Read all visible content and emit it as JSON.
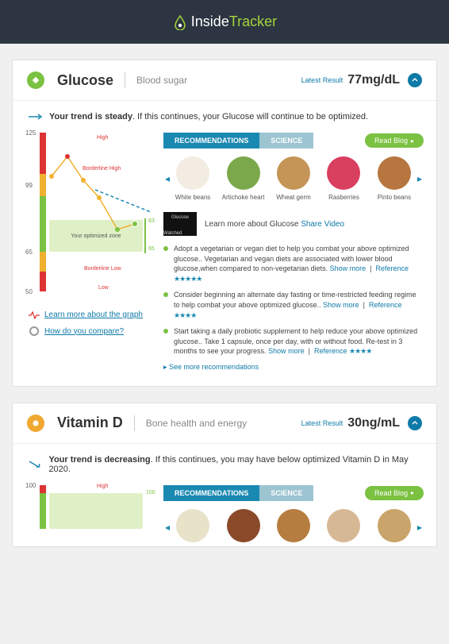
{
  "brand": {
    "name_prefix": "Inside",
    "name_suffix": "Tracker"
  },
  "panels": [
    {
      "icon_color": "green",
      "title": "Glucose",
      "subtitle": "Blood sugar",
      "latest_label": "Latest Result",
      "latest_value": "77mg/dL",
      "trend_prefix": "Your trend is steady",
      "trend_suffix": ". If this continues, your Glucose will continue to be optimized.",
      "trend_color": "#1a89b2",
      "chart": {
        "ticks": [
          "125",
          "99",
          "65",
          "50"
        ],
        "zones": [
          {
            "label": "High",
            "color": "#d33"
          },
          {
            "label": "Borderline High",
            "color": "#d33"
          },
          {
            "label": "Your optimized zone",
            "color": "#555"
          },
          {
            "label": "Borderline Low",
            "color": "#d33"
          },
          {
            "label": "Low",
            "color": "#d33"
          }
        ],
        "opt_markers": [
          "83",
          "65"
        ]
      },
      "links": {
        "learn_graph": "Learn more about the graph",
        "compare": "How do you compare?"
      },
      "tabs": {
        "rec": "RECOMMENDATIONS",
        "sci": "SCIENCE"
      },
      "blog_btn": "Read Blog",
      "foods": [
        {
          "name": "White beans",
          "color": "#f2ece2"
        },
        {
          "name": "Artichoke heart",
          "color": "#7ba84a"
        },
        {
          "name": "Wheat germ",
          "color": "#c49556"
        },
        {
          "name": "Rasberries",
          "color": "#d93f5f"
        },
        {
          "name": "Pinto beans",
          "color": "#b77640"
        }
      ],
      "video": {
        "watched": "Watched",
        "learn": "Learn more about Glucose",
        "share": "Share Video"
      },
      "recs": [
        {
          "text": "Adopt a vegetarian or vegan diet to help you combat your above optimized glucose.. Vegetarian and vegan diets are associated with lower blood glucose,when compared to non-vegetarian diets.",
          "show_more": "Show more",
          "reference": "Reference",
          "stars": "★★★★★"
        },
        {
          "text": "Consider beginning an alternate day fasting or time-restricted feeding regime to help combat your above optimized glucose..",
          "show_more": "Show more",
          "reference": "Reference",
          "stars": "★★★★"
        },
        {
          "text": "Start taking a daily probiotic supplement to help reduce your above optimized glucose.. Take 1 capsule, once per day, with or without food. Re-test in 3 months to see your progress.",
          "show_more": "Show more",
          "reference": "Reference",
          "stars": "★★★★"
        }
      ],
      "see_more": "See more recommendations"
    },
    {
      "icon_color": "orange",
      "title": "Vitamin D",
      "subtitle": "Bone health and energy",
      "latest_label": "Latest Result",
      "latest_value": "30ng/mL",
      "trend_prefix": "Your trend is decreasing",
      "trend_suffix": ". If this continues, you may have below optimized Vitamin D in May 2020.",
      "trend_color": "#1a89b2",
      "chart": {
        "ticks": [
          "100"
        ],
        "zones": [
          {
            "label": "High",
            "color": "#d33"
          }
        ],
        "opt_markers": [
          "100"
        ]
      },
      "tabs": {
        "rec": "RECOMMENDATIONS",
        "sci": "SCIENCE"
      },
      "blog_btn": "Read Blog"
    }
  ],
  "chart_data": [
    {
      "marker": "Glucose",
      "type": "line",
      "yaxis_ticks": [
        50,
        65,
        99,
        125
      ],
      "zones": {
        "low": [
          50,
          55
        ],
        "borderline_low": [
          55,
          65
        ],
        "optimized": [
          65,
          83
        ],
        "borderline_high": [
          83,
          99
        ],
        "high": [
          99,
          125
        ]
      },
      "series": [
        {
          "name": "Glucose result",
          "values": [
            93,
            105,
            95,
            88,
            72,
            75
          ],
          "color": "#f0b030"
        },
        {
          "name": "Projection",
          "style": "dashed",
          "values": [
            null,
            null,
            null,
            90,
            83,
            77,
            72
          ],
          "color": "#1a89b2"
        }
      ],
      "latest_value": 77,
      "unit": "mg/dL"
    },
    {
      "marker": "Vitamin D",
      "type": "line",
      "yaxis_ticks": [
        100
      ],
      "latest_value": 30,
      "unit": "ng/mL"
    }
  ]
}
